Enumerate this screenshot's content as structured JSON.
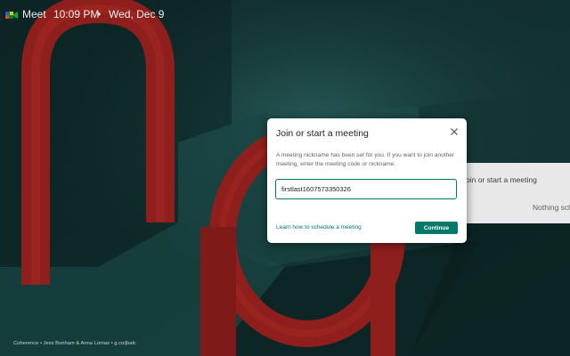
{
  "topbar": {
    "app_name": "Meet",
    "time": "10:09 PM",
    "separator": "•",
    "date": "Wed, Dec 9",
    "logo_icon": "google-meet-logo-icon"
  },
  "background_panel": {
    "title_fragment": "oin or start a meeting",
    "subtitle_fragment": "Nothing sch"
  },
  "dialog": {
    "title": "Join or start a meeting",
    "close_icon": "close-icon",
    "description": "A meeting nickname has been set for you. If you want to join another meeting, enter the meeting code or nickname.",
    "input_value": "firstlast1607573350326",
    "link_label": "Learn how to schedule a meeting",
    "continue_label": "Continue"
  },
  "background_credit": "Coherence • Jess Bonham & Anna Lomax • g.co/jbalc",
  "colors": {
    "accent": "#00796b",
    "background": "#0f2e2d",
    "arch": "#8e1f1c"
  }
}
